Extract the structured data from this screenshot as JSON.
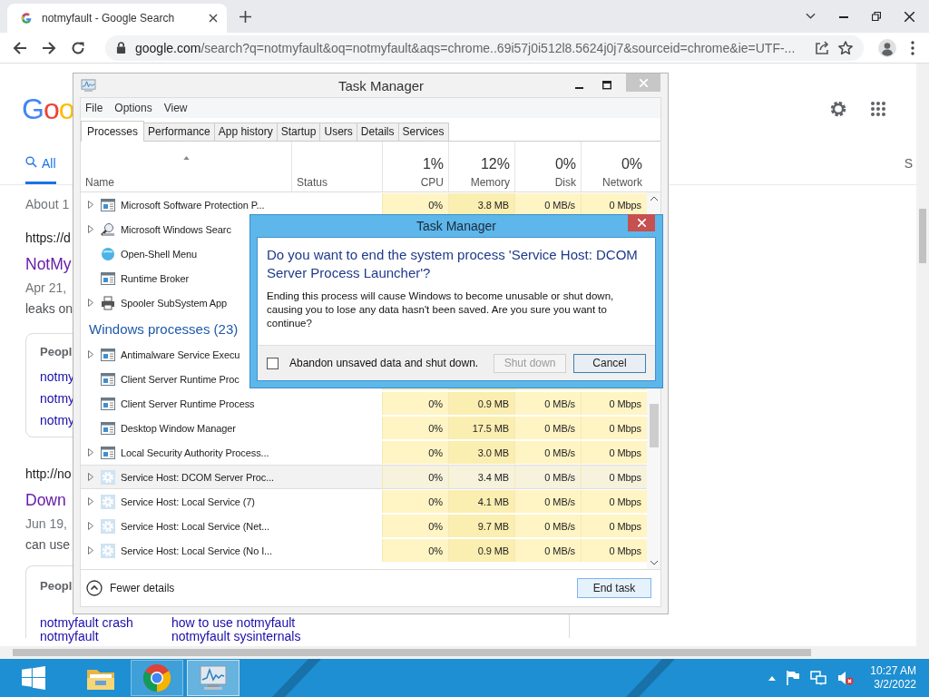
{
  "browser": {
    "tab": {
      "title": "notmyfault - Google Search"
    },
    "address": {
      "host": "google.com",
      "path": "/search?q=notmyfault&oq=notmyfault&aqs=chrome..69i57j0i512l8.5624j0j7&sourceid=chrome&ie=UTF-..."
    }
  },
  "page": {
    "logo": "Goo",
    "tabs": [
      {
        "label": "All",
        "selected": true
      },
      {
        "label": "S",
        "selected": false
      }
    ],
    "result_stats": "About 1",
    "blocks": [
      {
        "kind": "result",
        "url": "https://d",
        "title": "NotMy",
        "visited": true,
        "date": "Apr 21,",
        "snippet": "leaks on"
      },
      {
        "kind": "related",
        "heading": "Peopl",
        "links": [
          "notmy",
          "notmy",
          "notmy"
        ]
      },
      {
        "kind": "result",
        "url": "http://no",
        "title": "Down",
        "visited": true,
        "date": "Jun 19,",
        "snippet": "can use"
      },
      {
        "kind": "grid",
        "heading": "Peopl",
        "rows": [
          [
            "notmyfault crash",
            "how to use notmyfault"
          ],
          [
            "notmyfault",
            "notmyfault sysinternals"
          ]
        ]
      }
    ]
  },
  "task_manager": {
    "title": "Task Manager",
    "menu": [
      "File",
      "Options",
      "View"
    ],
    "tabs": [
      {
        "label": "Processes",
        "selected": true
      },
      {
        "label": "Performance",
        "selected": false
      },
      {
        "label": "App history",
        "selected": false
      },
      {
        "label": "Startup",
        "selected": false
      },
      {
        "label": "Users",
        "selected": false
      },
      {
        "label": "Details",
        "selected": false
      },
      {
        "label": "Services",
        "selected": false
      }
    ],
    "columns": [
      {
        "label": "Name",
        "sorted": true
      },
      {
        "label": "Status",
        "sorted": false
      },
      {
        "label": "CPU",
        "total": "1%",
        "sorted": false
      },
      {
        "label": "Memory",
        "total": "12%",
        "sorted": false
      },
      {
        "label": "Disk",
        "total": "0%",
        "sorted": false
      },
      {
        "label": "Network",
        "total": "0%",
        "sorted": false
      }
    ],
    "rows": [
      {
        "kind": "window",
        "name": "Microsoft Software Protection P...",
        "expandable": true,
        "selected": false,
        "cpu": "0%",
        "memory": "3.8 MB",
        "disk": "0 MB/s",
        "network": "0 Mbps"
      },
      {
        "kind": "search",
        "name": "Microsoft Windows Searc",
        "expandable": true,
        "selected": false
      },
      {
        "kind": "globe",
        "name": "Open-Shell Menu",
        "expandable": false,
        "selected": false
      },
      {
        "kind": "window",
        "name": "Runtime Broker",
        "expandable": false,
        "selected": false
      },
      {
        "kind": "printer",
        "name": "Spooler SubSystem App",
        "expandable": true,
        "selected": false
      },
      {
        "kind": "group",
        "name": "Windows processes (23)"
      },
      {
        "kind": "window",
        "name": "Antimalware Service Execu",
        "expandable": true,
        "selected": false
      },
      {
        "kind": "window",
        "name": "Client Server Runtime Proc",
        "expandable": false,
        "selected": false
      },
      {
        "kind": "window",
        "name": "Client Server Runtime Process",
        "expandable": false,
        "selected": false,
        "cpu": "0%",
        "memory": "0.9 MB",
        "disk": "0 MB/s",
        "network": "0 Mbps"
      },
      {
        "kind": "window",
        "name": "Desktop Window Manager",
        "expandable": false,
        "selected": false,
        "cpu": "0%",
        "memory": "17.5 MB",
        "disk": "0 MB/s",
        "network": "0 Mbps"
      },
      {
        "kind": "window",
        "name": "Local Security Authority Process...",
        "expandable": true,
        "selected": false,
        "cpu": "0%",
        "memory": "3.0 MB",
        "disk": "0 MB/s",
        "network": "0 Mbps"
      },
      {
        "kind": "gear",
        "name": "Service Host: DCOM Server Proc...",
        "expandable": true,
        "selected": true,
        "cpu": "0%",
        "memory": "3.4 MB",
        "disk": "0 MB/s",
        "network": "0 Mbps"
      },
      {
        "kind": "gear",
        "name": "Service Host: Local Service (7)",
        "expandable": true,
        "selected": false,
        "cpu": "0%",
        "memory": "4.1 MB",
        "disk": "0 MB/s",
        "network": "0 Mbps"
      },
      {
        "kind": "gear",
        "name": "Service Host: Local Service (Net...",
        "expandable": true,
        "selected": false,
        "cpu": "0%",
        "memory": "9.7 MB",
        "disk": "0 MB/s",
        "network": "0 Mbps"
      },
      {
        "kind": "gear",
        "name": "Service Host: Local Service (No I...",
        "expandable": true,
        "selected": false,
        "cpu": "0%",
        "memory": "0.9 MB",
        "disk": "0 MB/s",
        "network": "0 Mbps"
      }
    ],
    "footer": {
      "toggle": "Fewer details",
      "button": "End task"
    }
  },
  "dialog": {
    "title": "Task Manager",
    "question": "Do you want to end the system process 'Service Host: DCOM Server Process Launcher'?",
    "message": "Ending this process will cause Windows to become unusable or shut down, causing you to lose any data hasn't been saved. Are you sure you want to continue?",
    "checkbox": {
      "label": "Abandon unsaved data and shut down.",
      "checked": false
    },
    "buttons": [
      {
        "label": "Shut down",
        "disabled": true,
        "focused": false
      },
      {
        "label": "Cancel",
        "disabled": false,
        "focused": true
      }
    ]
  },
  "taskbar": {
    "apps": [
      {
        "kind": "explorer",
        "open": false,
        "selected": false
      },
      {
        "kind": "chrome",
        "open": true,
        "selected": false
      },
      {
        "kind": "taskmgr",
        "open": true,
        "selected": true
      }
    ],
    "clock": {
      "time": "10:27 AM",
      "date": "3/2/2022"
    }
  }
}
